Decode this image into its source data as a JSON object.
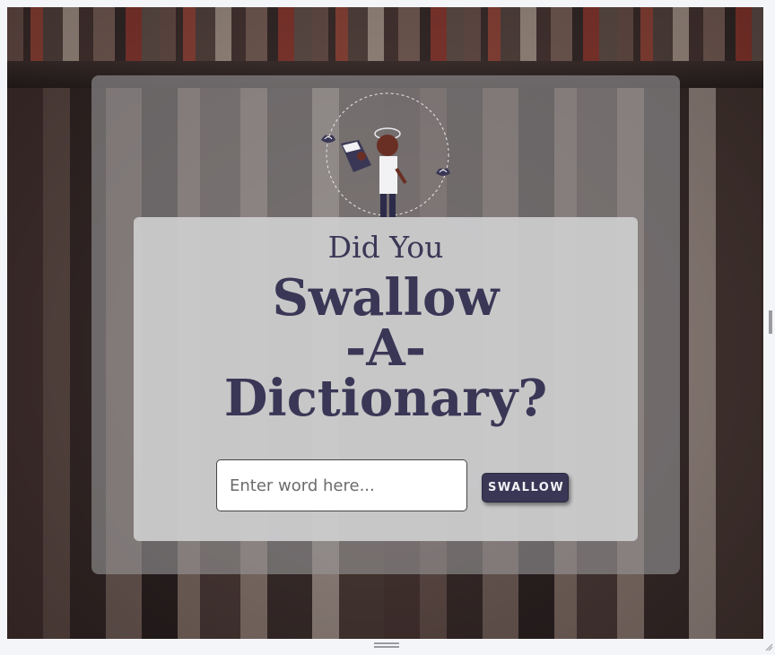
{
  "header": {
    "subtitle": "Did You",
    "title_line1": "Swallow",
    "title_line2": "-A-",
    "title_line3": "Dictionary?"
  },
  "search": {
    "placeholder": "Enter word here...",
    "value": "",
    "button_label": "SWALLOW"
  },
  "icons": {
    "logo": "reading-figure-logo-icon",
    "leaf_left": "leaf-icon",
    "leaf_right": "leaf-icon",
    "bottom_handle": "resize-handle-icon",
    "right_handle": "resize-handle-icon",
    "corner_grip": "resize-grip-icon"
  },
  "colors": {
    "accent": "#3a3756",
    "button_text": "#f1f1f5",
    "outer_card": "rgba(150,148,150,0.62)",
    "inner_card": "rgba(205,205,207,0.93)"
  }
}
